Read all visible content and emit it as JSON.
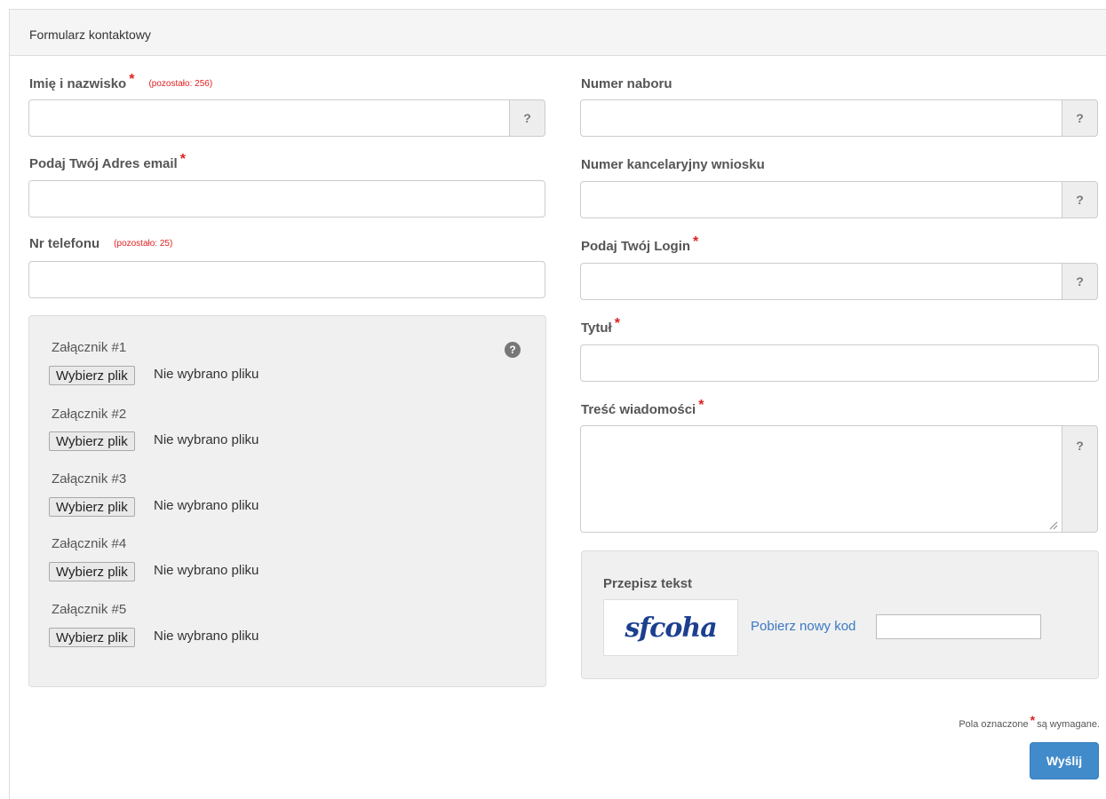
{
  "panel": {
    "title": "Formularz kontaktowy"
  },
  "fields": {
    "name": {
      "label": "Imię i nazwisko",
      "required_mark": "*",
      "remaining": "(pozostało: 256)",
      "value": "",
      "help": "?"
    },
    "email": {
      "label": "Podaj Twój Adres email",
      "required_mark": "*",
      "value": ""
    },
    "phone": {
      "label": "Nr telefonu",
      "remaining": "(pozostało: 25)",
      "value": ""
    },
    "call_number": {
      "label": "Numer naboru",
      "value": "",
      "help": "?"
    },
    "application_number": {
      "label": "Numer kancelaryjny wniosku",
      "value": "",
      "help": "?"
    },
    "login": {
      "label": "Podaj Twój Login",
      "required_mark": "*",
      "value": "",
      "help": "?"
    },
    "title": {
      "label": "Tytuł",
      "required_mark": "*",
      "value": ""
    },
    "message": {
      "label": "Treść wiadomości",
      "required_mark": "*",
      "value": "",
      "help": "?"
    }
  },
  "attachments": {
    "help_icon": "?",
    "items": [
      {
        "label": "Załącznik #1",
        "button": "Wybierz plik",
        "status": "Nie wybrano pliku"
      },
      {
        "label": "Załącznik #2",
        "button": "Wybierz plik",
        "status": "Nie wybrano pliku"
      },
      {
        "label": "Załącznik #3",
        "button": "Wybierz plik",
        "status": "Nie wybrano pliku"
      },
      {
        "label": "Załącznik #4",
        "button": "Wybierz plik",
        "status": "Nie wybrano pliku"
      },
      {
        "label": "Załącznik #5",
        "button": "Wybierz plik",
        "status": "Nie wybrano pliku"
      }
    ]
  },
  "captcha": {
    "label": "Przepisz tekst",
    "image_text": "sfcoha",
    "refresh_link": "Pobierz nowy kod",
    "value": ""
  },
  "footer": {
    "required_note_prefix": "Pola oznaczone",
    "required_mark": "*",
    "required_note_suffix": "są wymagane.",
    "submit_label": "Wyślij"
  },
  "colors": {
    "required": "#e02020",
    "link": "#3a78c3",
    "primary_button": "#428bca"
  },
  "icons": {
    "help": "question-circle-icon",
    "resize": "resize-grip-icon"
  }
}
